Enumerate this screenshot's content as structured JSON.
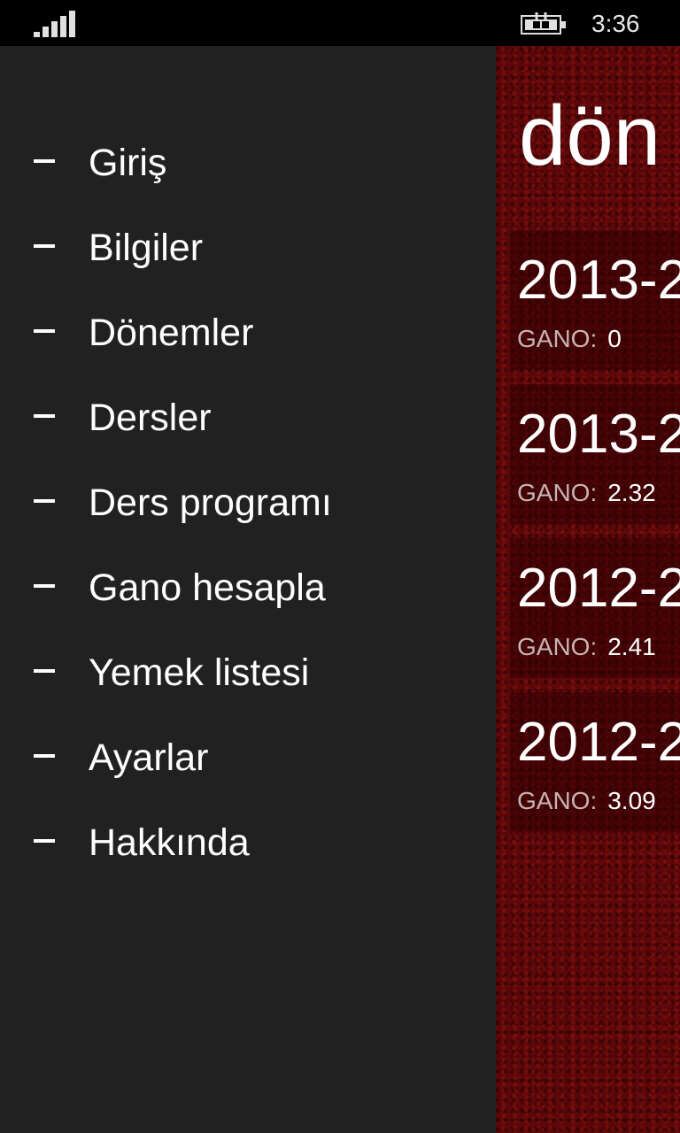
{
  "status_bar": {
    "time": "3:36",
    "signal_icon": "signal-bars-icon",
    "battery_icon": "battery-charging-icon"
  },
  "nav": {
    "items": [
      {
        "label": "Giriş"
      },
      {
        "label": "Bilgiler"
      },
      {
        "label": "Dönemler"
      },
      {
        "label": "Dersler"
      },
      {
        "label": "Ders programı"
      },
      {
        "label": "Gano hesapla"
      },
      {
        "label": "Yemek listesi"
      },
      {
        "label": "Ayarlar"
      },
      {
        "label": "Hakkında"
      }
    ]
  },
  "content": {
    "title": "dön",
    "terms": [
      {
        "year": "2013-2",
        "gano_label": "GANO:",
        "gano_value": "0"
      },
      {
        "year": "2013-2",
        "gano_label": "GANO:",
        "gano_value": "2.32"
      },
      {
        "year": "2012-2",
        "gano_label": "GANO:",
        "gano_value": "2.41"
      },
      {
        "year": "2012-2",
        "gano_label": "GANO:",
        "gano_value": "3.09"
      }
    ]
  },
  "colors": {
    "drawer_background": "#212121",
    "content_background": "#5e0709",
    "status_bar_background": "#000000"
  }
}
